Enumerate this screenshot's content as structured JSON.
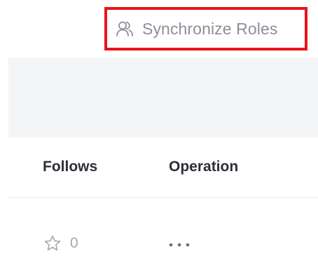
{
  "toolbar": {
    "sync_roles_label": "Synchronize Roles",
    "sync_roles_icon": "users-icon",
    "highlight_color": "#e8141c"
  },
  "table": {
    "columns": [
      {
        "label": "Follows"
      },
      {
        "label": "Operation"
      }
    ],
    "rows": [
      {
        "follows_count": "0",
        "follow_icon": "star-outline-icon",
        "operation_icon": "more-horizontal-icon"
      }
    ]
  }
}
